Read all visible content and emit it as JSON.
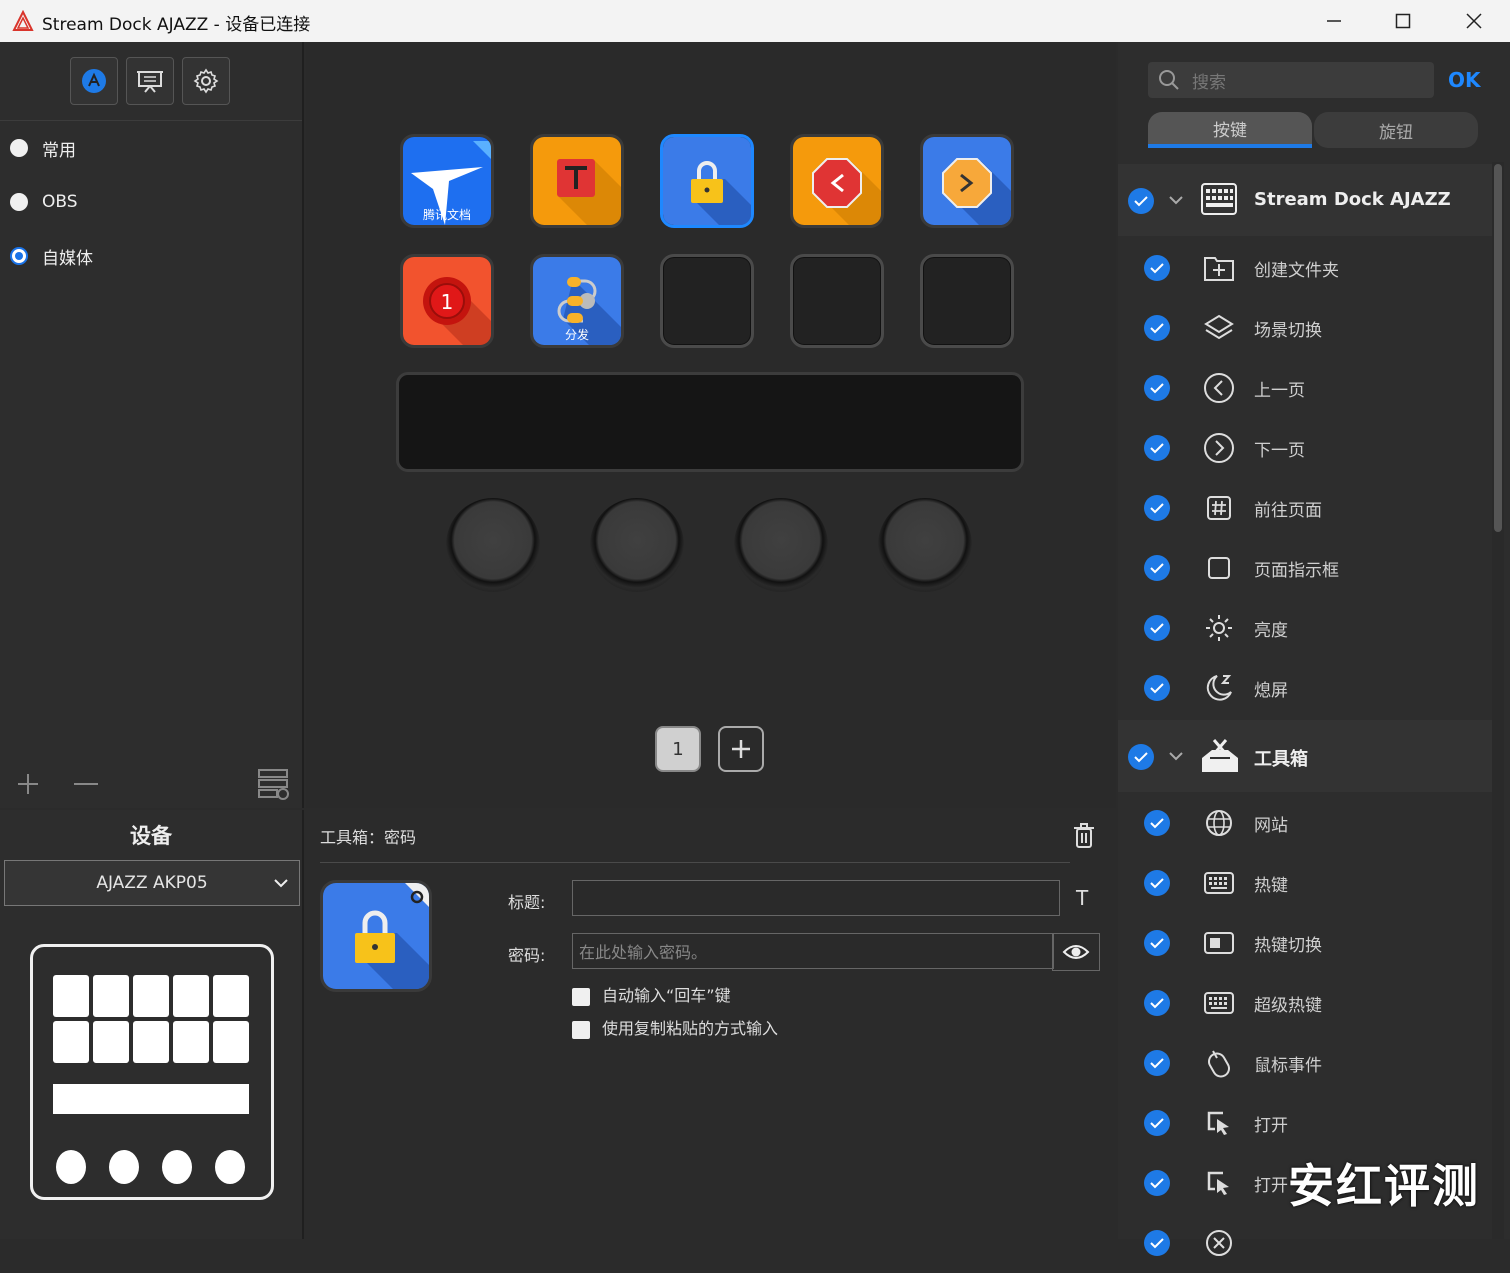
{
  "window": {
    "title": "Stream Dock AJAZZ - 设备已连接",
    "controls": [
      "minimize",
      "maximize",
      "close"
    ]
  },
  "sidebar": {
    "profiles": [
      {
        "label": "常用",
        "selected": false
      },
      {
        "label": "OBS",
        "selected": false
      },
      {
        "label": "自媒体",
        "selected": true
      }
    ]
  },
  "device": {
    "heading": "设备",
    "selected_model": "AJAZZ AKP05"
  },
  "keypad": {
    "keys_row1": [
      {
        "icon": "tencent-docs-icon",
        "caption": "腾讯文档"
      },
      {
        "icon": "text-t-icon",
        "caption": ""
      },
      {
        "icon": "lock-icon",
        "caption": "",
        "selected": true
      },
      {
        "icon": "previous-page-icon",
        "caption": ""
      },
      {
        "icon": "next-page-icon",
        "caption": ""
      }
    ],
    "keys_row2": [
      {
        "icon": "record-one-icon",
        "caption": ""
      },
      {
        "icon": "dispatch-icon",
        "caption": "分发"
      },
      {
        "icon": "empty",
        "caption": ""
      },
      {
        "icon": "empty",
        "caption": ""
      },
      {
        "icon": "empty",
        "caption": ""
      }
    ],
    "pages": {
      "current": "1",
      "add_label": "+"
    }
  },
  "props": {
    "header": "工具箱：密码",
    "title_label": "标题:",
    "title_value": "",
    "password_label": "密码:",
    "password_placeholder": "在此处输入密码。",
    "auto_enter_label": "自动输入“回车”键",
    "auto_enter_checked": false,
    "paste_label": "使用复制粘贴的方式输入",
    "paste_checked": false
  },
  "actions": {
    "search_placeholder": "搜索",
    "ok_label": "OK",
    "tabs": [
      {
        "label": "按键",
        "active": true
      },
      {
        "label": "旋钮",
        "active": false
      }
    ],
    "group1": {
      "title": "Stream Dock AJAZZ",
      "items": [
        "创建文件夹",
        "场景切换",
        "上一页",
        "下一页",
        "前往页面",
        "页面指示框",
        "亮度",
        "熄屏"
      ]
    },
    "group2": {
      "title": "工具箱",
      "items": [
        "网站",
        "热键",
        "热键切换",
        "超级热键",
        "鼠标事件",
        "打开",
        "打开"
      ]
    }
  },
  "watermark": "安红评测",
  "colors": {
    "accent": "#1e7ae6",
    "ok": "#1e88ff",
    "background": "#2b2b2b",
    "titlebar": "#f3f3f3"
  }
}
